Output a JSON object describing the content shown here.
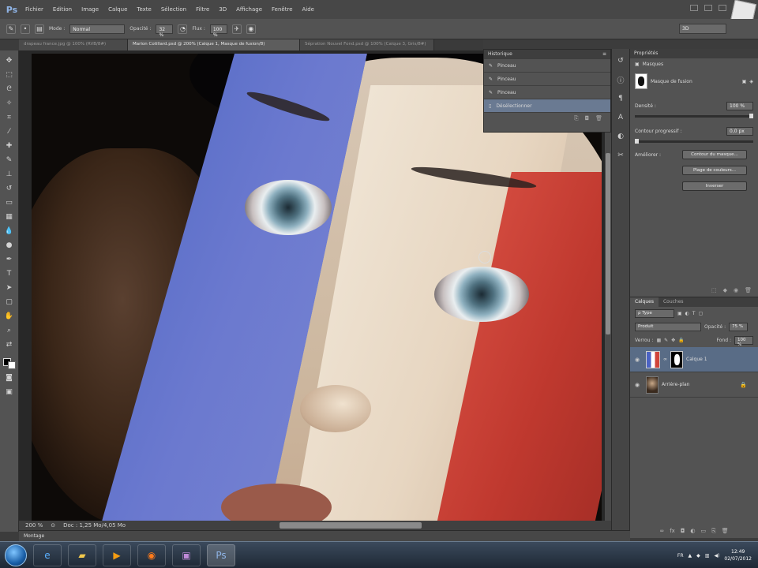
{
  "app": {
    "logo": "Ps",
    "menu": [
      "Fichier",
      "Edition",
      "Image",
      "Calque",
      "Texte",
      "Sélection",
      "Filtre",
      "3D",
      "Affichage",
      "Fenêtre",
      "Aide"
    ]
  },
  "options_bar": {
    "mode_label": "Mode :",
    "mode_value": "Normal",
    "opacity_label": "Opacité :",
    "opacity_value": "32 %",
    "flow_label": "Flux :",
    "flow_value": "100 %",
    "workspace_value": "3D"
  },
  "tabs": [
    {
      "label": "drapeau france.jpg @ 100% (RVB/8#)",
      "active": false
    },
    {
      "label": "Marion Cotillard.psd @ 200% (Calque 1, Masque de fusion/8)",
      "active": true
    },
    {
      "label": "Sépration Nouvel Fond.psd @ 100% (Calque 3, Gris/8#)",
      "active": false
    }
  ],
  "history": {
    "title": "Historique",
    "items": [
      {
        "label": "Pinceau",
        "active": false
      },
      {
        "label": "Pinceau",
        "active": false
      },
      {
        "label": "Pinceau",
        "active": false
      },
      {
        "label": "Désélectionner",
        "active": true
      }
    ]
  },
  "properties": {
    "title": "Propriétés",
    "section": "Masques",
    "mask_type": "Masque de fusion",
    "density_label": "Densité :",
    "density_value": "100 %",
    "feather_label": "Contour progressif :",
    "feather_value": "0,0 px",
    "refine_label": "Améliorer :",
    "buttons": [
      "Contour du masque...",
      "Plage de couleurs...",
      "Inverser"
    ]
  },
  "layers": {
    "tabs": [
      "Calques",
      "Couches"
    ],
    "filter_label": "ρ Type",
    "blend_mode": "Produit",
    "opacity_label": "Opacité :",
    "opacity_value": "75 %",
    "lock_label": "Verrou :",
    "fill_label": "Fond :",
    "fill_value": "100 %",
    "items": [
      {
        "name": "Calque 1",
        "active": true
      },
      {
        "name": "Arrière-plan",
        "active": false
      }
    ]
  },
  "status": {
    "zoom": "200 %",
    "doc_info": "Doc : 1,25 Mo/4,05 Mo"
  },
  "minibridge": {
    "label": "Montage"
  },
  "taskbar": {
    "language": "FR",
    "time": "12:49",
    "date": "02/07/2012"
  },
  "colors": {
    "flag_blue": "#5b6fc8",
    "flag_white": "#efe4d4",
    "flag_red": "#c0392f",
    "selection": "#596c86"
  }
}
